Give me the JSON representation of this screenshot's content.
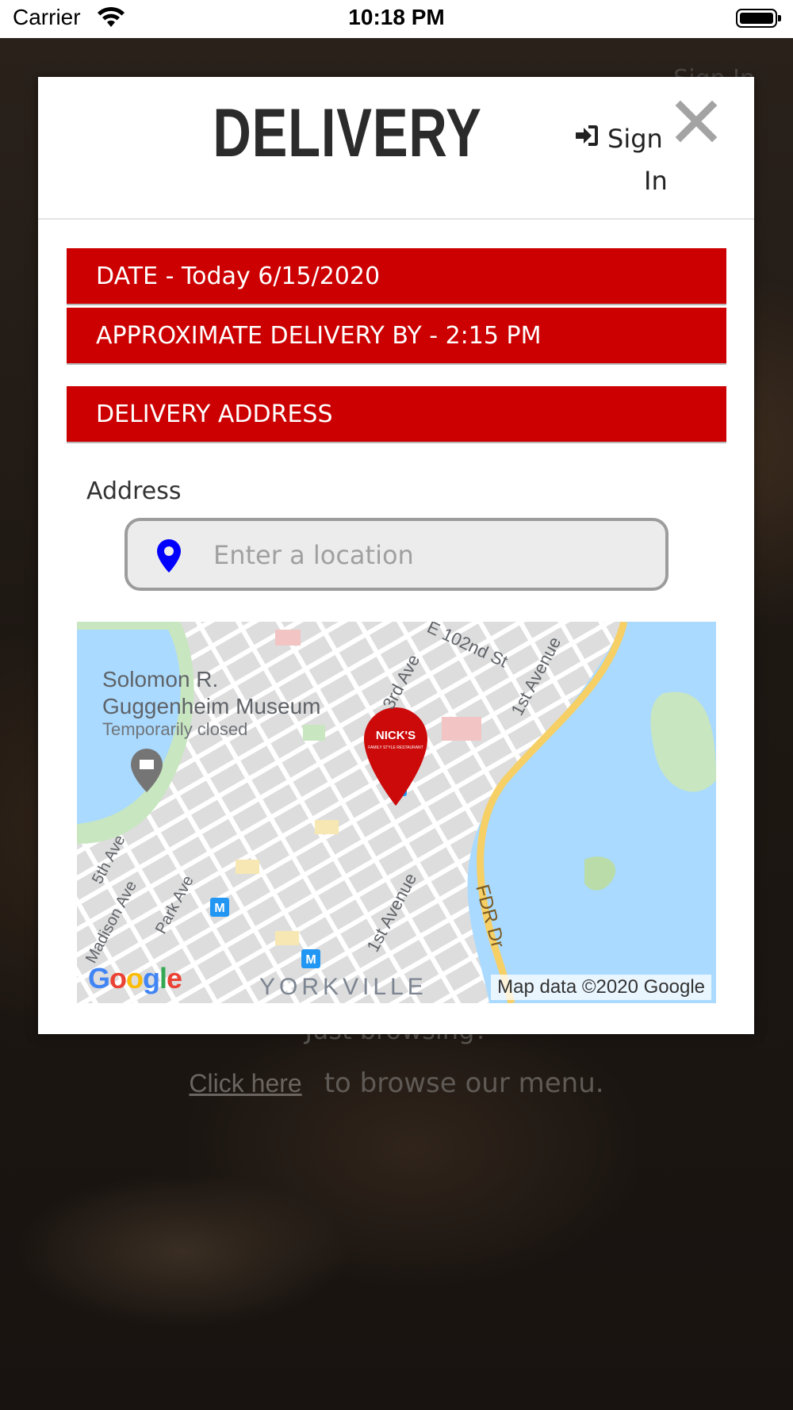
{
  "status_bar": {
    "carrier": "Carrier",
    "time": "10:18 PM"
  },
  "background": {
    "sign_in": "Sign In",
    "browsing": "Just browsing?",
    "click_here": "Click here",
    "browse_text": "to browse our menu."
  },
  "modal": {
    "title": "DELIVERY",
    "sign_in_top": "Sign",
    "sign_in_bottom": "In",
    "date_bar": "DATE - Today 6/15/2020",
    "approx_bar": "APPROXIMATE DELIVERY BY - 2:15 PM",
    "address_bar": "DELIVERY ADDRESS",
    "address_label": "Address",
    "address_placeholder": "Enter a location",
    "address_value": ""
  },
  "map": {
    "labels": {
      "museum_line1": "Solomon R.",
      "museum_line2": "Guggenheim Museum",
      "museum_status": "Temporarily closed",
      "st_102": "E 102nd St",
      "third_ave": "3rd Ave",
      "first_avenue_top": "1st Avenue",
      "fifth_ave": "5th Ave",
      "madison_ave": "Madison Ave",
      "park_ave": "Park Ave",
      "first_avenue_bottom": "1st Avenue",
      "fdr": "FDR Dr",
      "yorkville": "YORKVILLE"
    },
    "marker_brand": "NICK'S",
    "marker_tag": "FAMILY STYLE RESTAURANT",
    "credit": "Map data ©2020 Google",
    "logo": "Google",
    "colors": {
      "water": "#aadaff",
      "park": "#c8e6c0",
      "highway": "#f6cf65",
      "road": "#ffffff",
      "block": "#dcdcdc"
    }
  },
  "colors": {
    "accent_red": "#cc0000",
    "pin_blue": "#0000ff"
  }
}
